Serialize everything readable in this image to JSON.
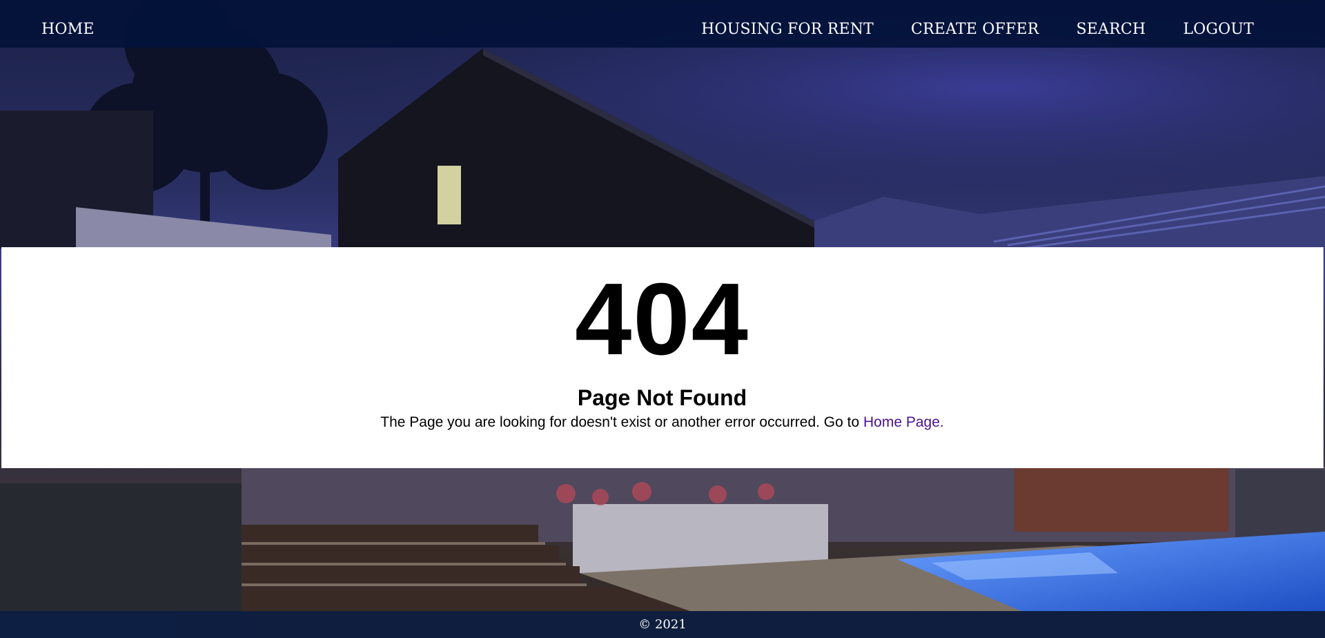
{
  "nav": {
    "home_label": "HOME",
    "links": [
      {
        "label": "HOUSING FOR RENT"
      },
      {
        "label": "CREATE OFFER"
      },
      {
        "label": "SEARCH"
      },
      {
        "label": "LOGOUT"
      }
    ]
  },
  "error": {
    "code": "404",
    "title": "Page Not Found",
    "message_prefix": "The Page you are looking for doesn't exist or another error occurred. Go to ",
    "home_link_label": "Home Page."
  },
  "footer": {
    "copyright": "© 2021"
  },
  "colors": {
    "nav_background": "#03123a",
    "link_accent": "#4b1191",
    "panel_background": "#ffffff"
  }
}
